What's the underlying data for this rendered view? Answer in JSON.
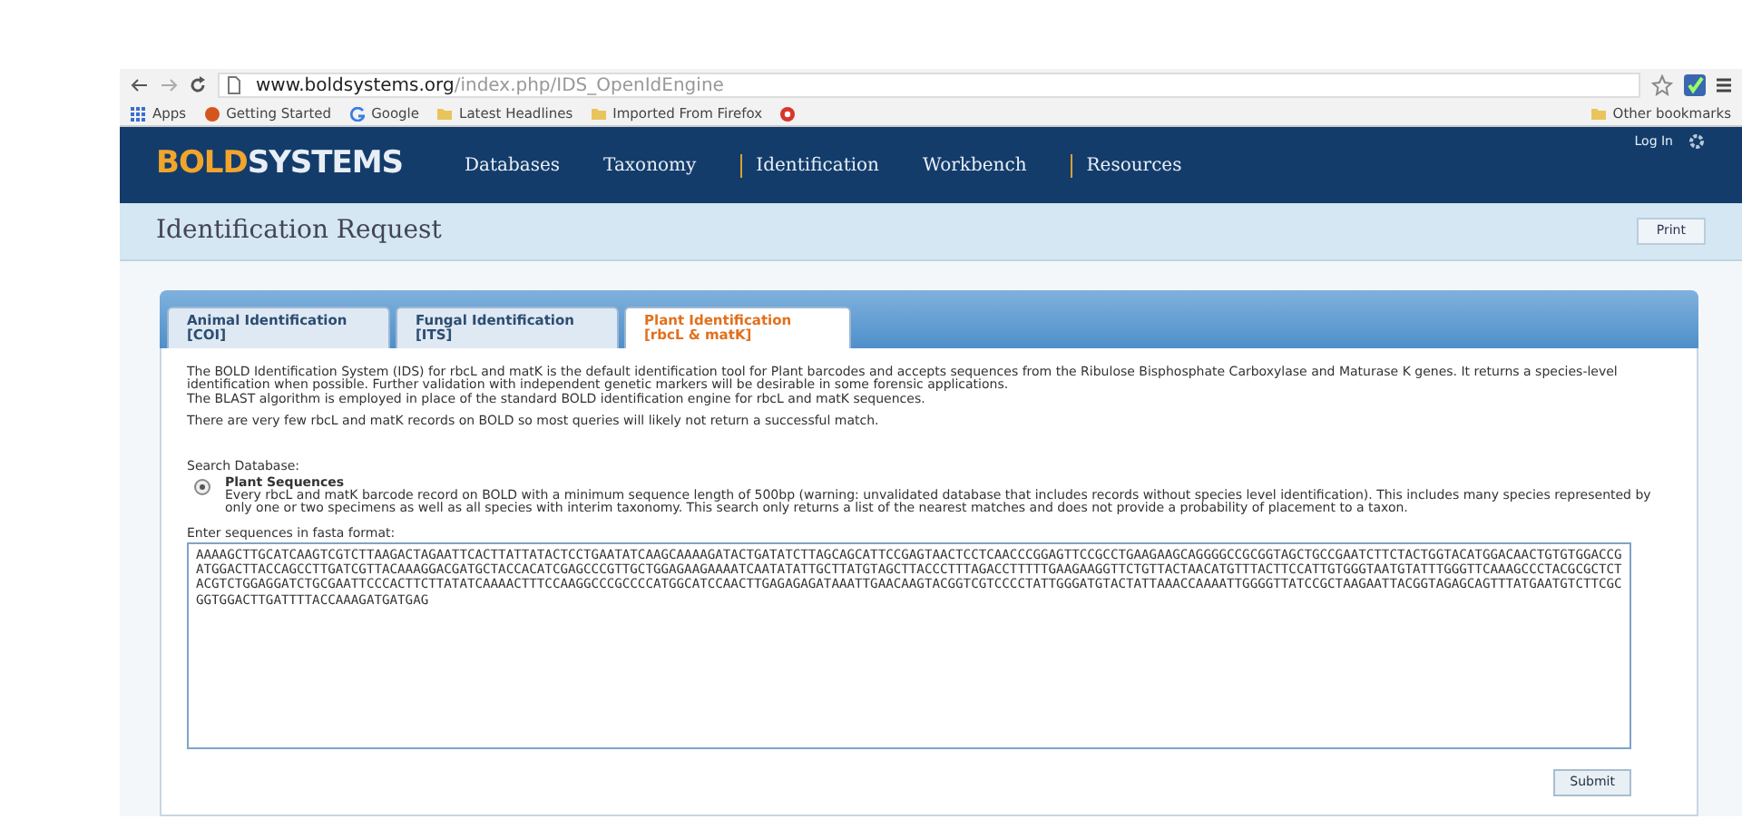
{
  "browser": {
    "url_host": "www.boldsystems.org",
    "url_path": "/index.php/IDS_OpenIdEngine",
    "bookmarks": [
      {
        "label": "Apps",
        "kind": "apps"
      },
      {
        "label": "Getting Started",
        "kind": "page"
      },
      {
        "label": "Google",
        "kind": "google"
      },
      {
        "label": "Latest Headlines",
        "kind": "folder"
      },
      {
        "label": "Imported From Firefox",
        "kind": "folder"
      },
      {
        "kind": "extension"
      }
    ],
    "other_bookmarks": "Other bookmarks"
  },
  "navbar": {
    "logo_bold": "BOLD",
    "logo_rest": "SYSTEMS",
    "items": [
      {
        "label": "Databases",
        "divider_before": false
      },
      {
        "label": "Taxonomy",
        "divider_before": false
      },
      {
        "label": "Identification",
        "divider_before": true
      },
      {
        "label": "Workbench",
        "divider_before": false
      },
      {
        "label": "Resources",
        "divider_before": true
      }
    ],
    "login": "Log In"
  },
  "page_header": {
    "title": "Identification Request",
    "print": "Print"
  },
  "tabs": [
    {
      "label": "Animal Identification",
      "sub": "[COI]",
      "selected": false
    },
    {
      "label": "Fungal Identification",
      "sub": "[ITS]",
      "selected": false
    },
    {
      "label": "Plant Identification",
      "sub": "[rbcL & matK]",
      "selected": true
    }
  ],
  "description": [
    "The BOLD Identification System (IDS) for rbcL and matK is the default identification tool for Plant barcodes and accepts sequences from the Ribulose Bisphosphate Carboxylase and Maturase K genes. It returns a species-level identification when possible. Further validation with independent genetic markers will be desirable in some forensic applications.",
    "The BLAST algorithm is employed in place of the standard BOLD identification engine for rbcL and matK sequences.",
    "There are very few rbcL and matK records on BOLD so most queries will likely not return a successful match."
  ],
  "search_database": {
    "label": "Search Database:",
    "options": [
      {
        "title": "Plant Sequences",
        "text": "Every rbcL and matK barcode record on BOLD with a minimum sequence length of 500bp (warning: unvalidated database that includes records without species level identification). This includes many species represented by only one or two specimens as well as all species with interim taxonomy. This search only returns a list of the nearest matches and does not provide a probability of placement to a taxon.",
        "selected": true
      }
    ]
  },
  "sequence_input": {
    "label": "Enter sequences in fasta format:",
    "value": "AAAAGCTTGCATCAAGTCGTCTTAAGACTAGAATTCACTTATTATACTCCTGAATATCAAGCAAAAGATACTGATATCTTAGCAGCATTCCGAGTAACTCCTCAACCCGGAGTTCCGCCTGAAGAAGCAGGGGCCGCGGTAGCTGCCGAATCTTCTACTGGTACATGGACAACTGTGTGGACCGATGGACTTACCAGCCTTGATCGTTACAAAGGACGATGCTACCACATCGAGCCCGTTGCTGGAGAAGAAAATCAATATATTGCTTATGTAGCTTACCCTTTAGACCTTTTTGAAGAAGGTTCTGTTACTAACATGTTTACTTCCATTGTGGGTAATGTATTTGGGTTCAAAGCCCTACGCGCTCTACGTCTGGAGGATCTGCGAATTCCCACTTCTTATATCAAAACTTTCCAAGGCCCGCCCCATGGCATCCAACTTGAGAGAGATAAATTGAACAAGTACGGTCGTCCCCTATTGGGATGTACTATTAAACCAAAATTGGGGTTATCCGCTAAGAATTACGGTAGAGCAGTTTATGAATGTCTTCGCGGTGGACTTGATTTTACCAAAGATGATGAG"
  },
  "submit": "Submit"
}
